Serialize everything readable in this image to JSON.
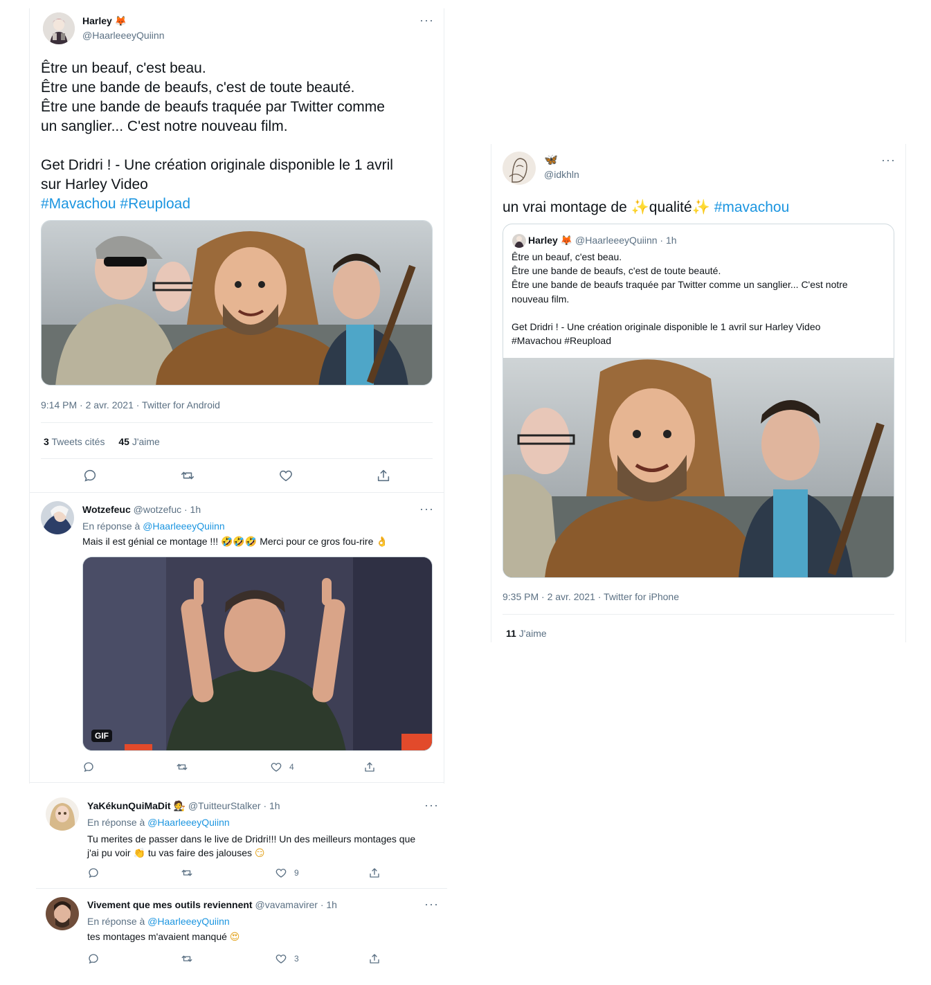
{
  "colors": {
    "link": "#1b95e0",
    "muted": "#5b7083",
    "text": "#0f1419",
    "border": "#ebeef0"
  },
  "main_tweet": {
    "name": "Harley",
    "name_emoji": "🦊",
    "handle": "@HaarleeeyQuiinn",
    "lines": [
      "Être un beauf, c'est beau.",
      "Être une bande de beaufs, c'est de toute beauté.",
      "Être une bande de beaufs traquée par Twitter comme",
      "un sanglier... C'est notre nouveau film.",
      "Get Dridri ! - Une création originale disponible le 1 avril",
      "sur Harley Video"
    ],
    "hashtags": [
      "#Mavachou",
      "#Reupload"
    ],
    "image_icon": "movie-still-image",
    "meta": "9:14 PM · 2 avr. 2021 · Twitter for Android",
    "quotes_count": "3",
    "quotes_label": "Tweets cités",
    "likes_count": "45",
    "likes_label": "J'aime",
    "actions": [
      "reply-icon",
      "retweet-icon",
      "like-icon",
      "share-icon"
    ]
  },
  "reply1": {
    "name": "Wotzefeuc",
    "handle": "@wotzefuc",
    "time": "· 1h",
    "reply_prefix": "En réponse à",
    "reply_to": "@HaarleeeyQuiinn",
    "text_before": "Mais il est génial ce montage !!!",
    "emoji1": "🤣🤣🤣",
    "text_after": "Merci pour ce gros fou-rire",
    "emoji2": "👌",
    "gif_label": "GIF",
    "like_count": "4"
  },
  "reply2": {
    "name": "YaKékunQuiMaDit",
    "name_emoji": "🧑‍⚖️",
    "handle": "@TuitteurStalker",
    "time": "· 1h",
    "reply_prefix": "En réponse à",
    "reply_to": "@HaarleeeyQuiinn",
    "line1": "Tu merites de passer dans le live de Dridri!!! Un des meilleurs montages que",
    "line2_before": "j'ai pu voir",
    "emoji1": "👏",
    "line2_mid": "tu vas faire des jalouses",
    "emoji2": "😏",
    "like_count": "9"
  },
  "reply3": {
    "name": "Vivement que mes outils reviennent",
    "handle": "@vavamavirer",
    "time": "· 1h",
    "reply_prefix": "En réponse à",
    "reply_to": "@HaarleeeyQuiinn",
    "text": "tes montages m'avaient manqué",
    "emoji": "😍",
    "like_count": "3"
  },
  "quote_tweet": {
    "name_emoji": "🦋",
    "handle": "@idkhln",
    "text_before": "un vrai montage de",
    "sparkle": "✨",
    "text_mid": "qualité",
    "hashtag": "#mavachou",
    "quoted": {
      "name": "Harley",
      "name_emoji": "🦊",
      "handle": "@HaarleeeyQuiinn",
      "time": "· 1h",
      "lines": [
        "Être un beauf, c'est beau.",
        "Être une bande de beaufs, c'est de toute beauté.",
        "Être une bande de beaufs traquée par Twitter comme un sanglier... C'est notre",
        "nouveau film.",
        "Get Dridri ! - Une création originale disponible le 1 avril sur Harley Video",
        "#Mavachou #Reupload"
      ]
    },
    "meta": "9:35 PM · 2 avr. 2021 · Twitter for iPhone",
    "likes_count": "11",
    "likes_label": "J'aime"
  }
}
